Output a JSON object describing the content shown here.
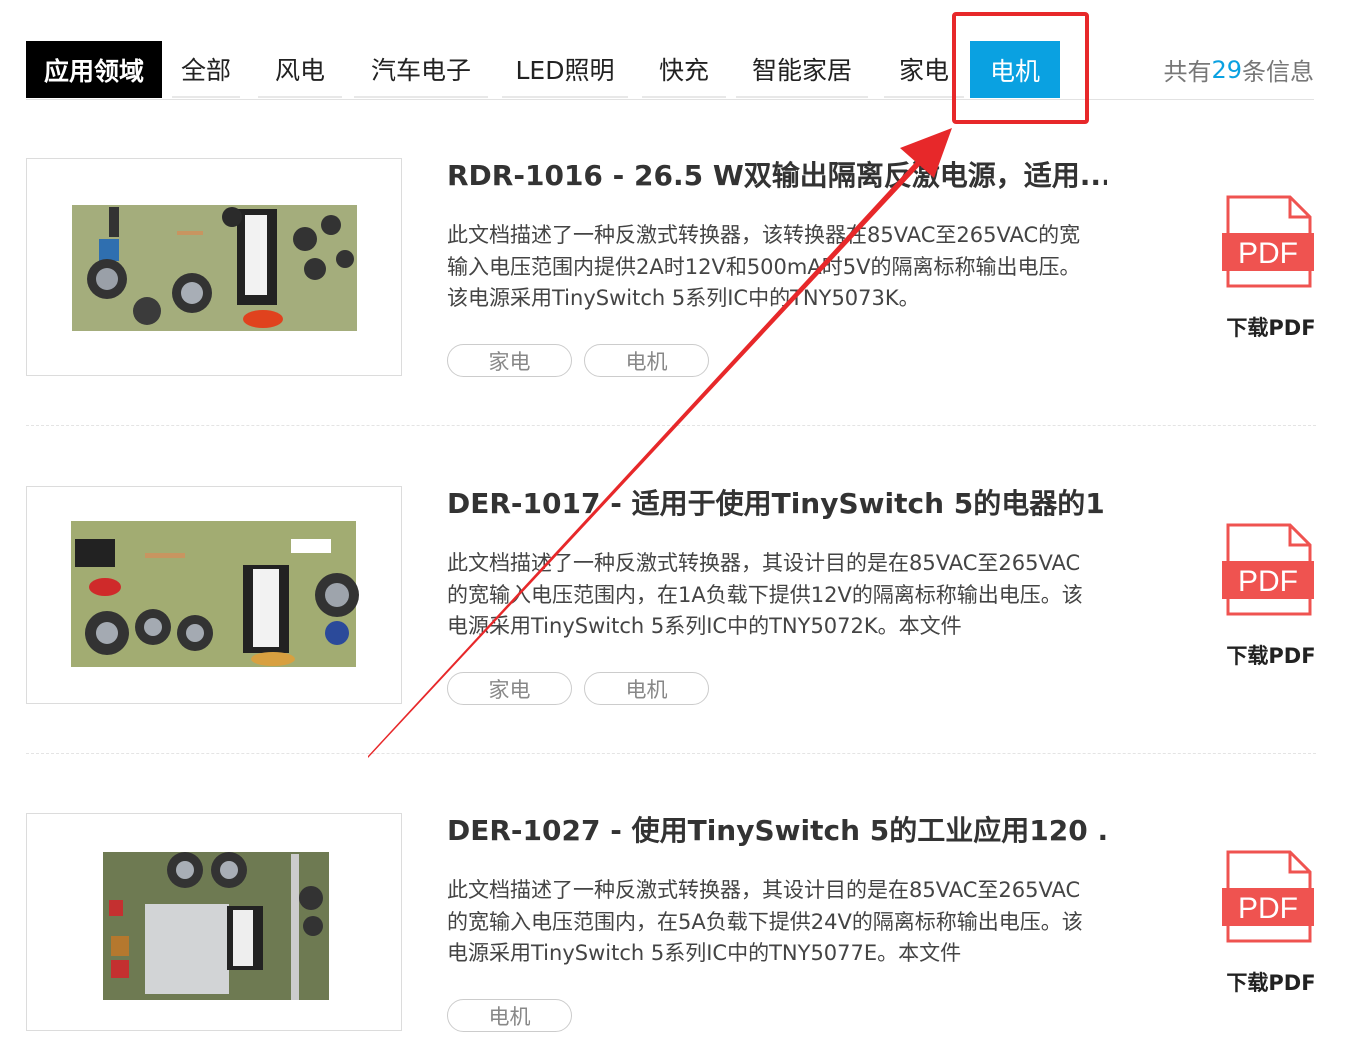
{
  "tabbar": {
    "label": "应用领域",
    "tabs": [
      "全部",
      "风电",
      "汽车电子",
      "LED照明",
      "快充",
      "智能家居",
      "家电",
      "电机"
    ],
    "active": "电机",
    "count_prefix": "共有",
    "count": "29",
    "count_suffix": "条信息"
  },
  "items": [
    {
      "title": "RDR-1016 - 26.5 W双输出隔离反激电源，适用...",
      "desc": "此文档描述了一种反激式转换器，该转换器在85VAC至265VAC的宽输入电压范围内提供2A时12V和500mA时5V的隔离标称输出电压。该电源采用TinySwitch 5系列IC中的TNY5073K。",
      "tags": [
        "家电",
        "电机"
      ],
      "pdf_icon": "PDF",
      "pdf_label": "下载PDF"
    },
    {
      "title": "DER-1017 - 适用于使用TinySwitch 5的电器的1...",
      "desc": "此文档描述了一种反激式转换器，其设计目的是在85VAC至265VAC的宽输入电压范围内，在1A负载下提供12V的隔离标称输出电压。该电源采用TinySwitch 5系列IC中的TNY5072K。本文件",
      "tags": [
        "家电",
        "电机"
      ],
      "pdf_icon": "PDF",
      "pdf_label": "下载PDF"
    },
    {
      "title": "DER-1027 - 使用TinySwitch 5的工业应用120 ...",
      "desc": "此文档描述了一种反激式转换器，其设计目的是在85VAC至265VAC的宽输入电压范围内，在5A负载下提供24V的隔离标称输出电压。该电源采用TinySwitch 5系列IC中的TNY5077E。本文件",
      "tags": [
        "电机"
      ],
      "pdf_icon": "PDF",
      "pdf_label": "下载PDF"
    }
  ],
  "colors": {
    "accent": "#0aa1e1",
    "highlight": "#e7282a",
    "pdf": "#ef5350"
  }
}
